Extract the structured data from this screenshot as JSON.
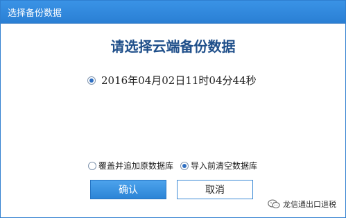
{
  "window": {
    "title": "选择备份数据"
  },
  "dialog": {
    "heading": "请选择云端备份数据",
    "backup_option": {
      "label": "2016年04月02日11时04分44秒",
      "selected": true
    },
    "restore_modes": [
      {
        "label": "覆盖并追加原数据库",
        "selected": false
      },
      {
        "label": "导入前清空数据库",
        "selected": true
      }
    ],
    "confirm_label": "确认",
    "cancel_label": "取消"
  },
  "watermark": {
    "text": "龙信通出口退税",
    "icon": "wechat-icon"
  },
  "colors": {
    "title_bar": "#2a7fd4",
    "heading": "#1f4f8a",
    "primary_button": "#2b84d6",
    "border": "#2f7fd0"
  }
}
